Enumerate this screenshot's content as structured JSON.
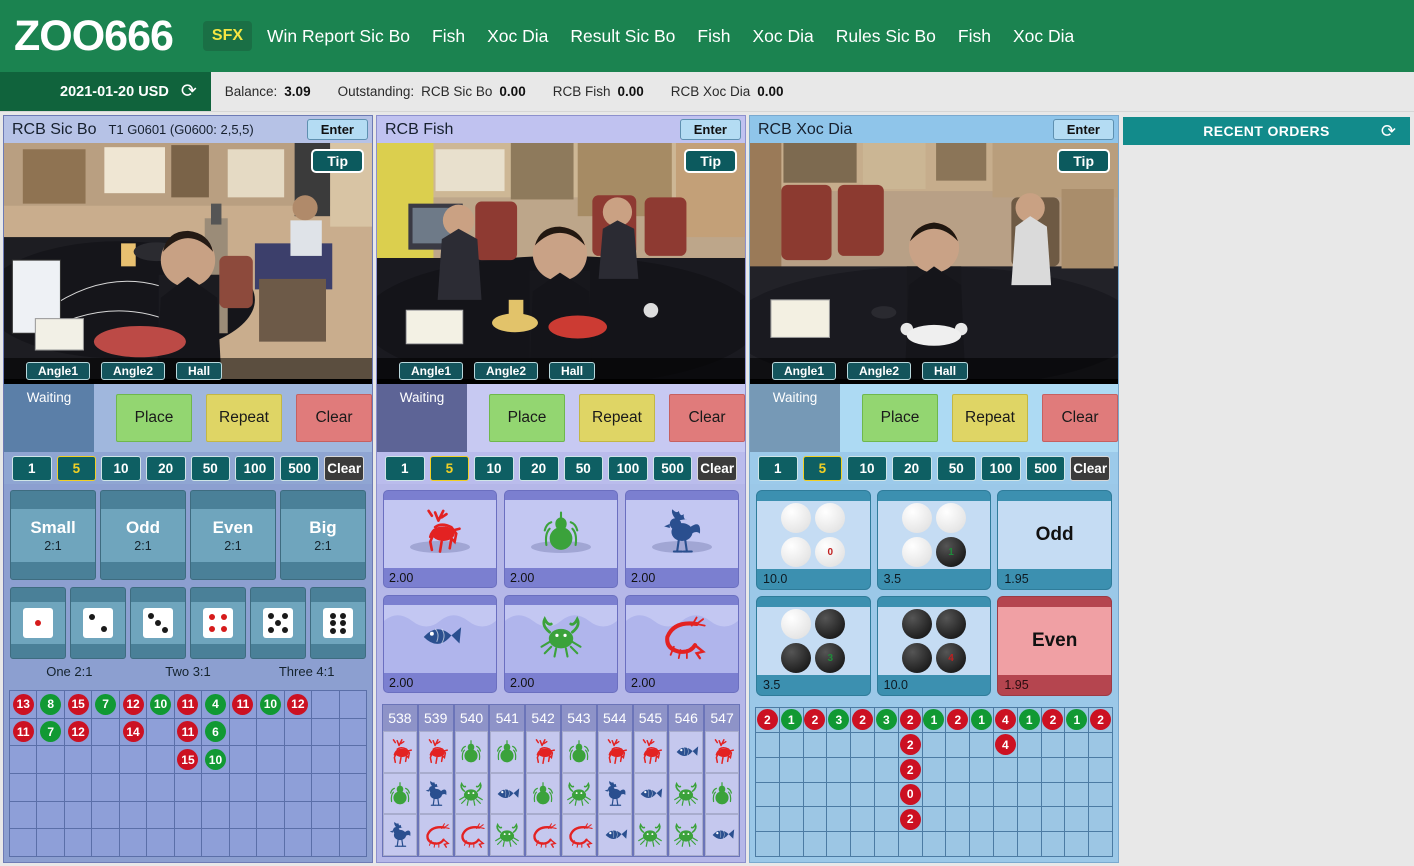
{
  "topnav": {
    "brand": "ZOO666",
    "items": [
      {
        "label": "SFX",
        "active": true
      },
      {
        "label": "Win Report Sic Bo",
        "active": false
      },
      {
        "label": "Fish",
        "active": false
      },
      {
        "label": "Xoc Dia",
        "active": false
      },
      {
        "label": "Result Sic Bo",
        "active": false
      },
      {
        "label": "Fish",
        "active": false
      },
      {
        "label": "Xoc Dia",
        "active": false
      },
      {
        "label": "Rules Sic Bo",
        "active": false
      },
      {
        "label": "Fish",
        "active": false
      },
      {
        "label": "Xoc Dia",
        "active": false
      }
    ]
  },
  "infobar": {
    "date": "2021-01-20 USD",
    "refresh_icon": "refresh-icon",
    "balance_label": "Balance:",
    "balance_value": "3.09",
    "outstanding_label": "Outstanding:",
    "outstanding": [
      {
        "label": "RCB Sic Bo",
        "value": "0.00"
      },
      {
        "label": "RCB Fish",
        "value": "0.00"
      },
      {
        "label": "RCB Xoc Dia",
        "value": "0.00"
      }
    ]
  },
  "common": {
    "enter_label": "Enter",
    "tip_label": "Tip",
    "angle_buttons": [
      "Angle1",
      "Angle2",
      "Hall"
    ],
    "status_waiting": "Waiting",
    "place_label": "Place",
    "repeat_label": "Repeat",
    "clear_label": "Clear",
    "chips": [
      "1",
      "5",
      "10",
      "20",
      "50",
      "100",
      "500"
    ],
    "chip_clear": "Clear",
    "chip_selected": "5"
  },
  "sicbo": {
    "title": "RCB Sic Bo",
    "game_info": "T1 G0601 (G0600: 2,5,5)",
    "bets_row1": [
      {
        "name": "Small",
        "odds": "2:1"
      },
      {
        "name": "Odd",
        "odds": "2:1"
      },
      {
        "name": "Even",
        "odds": "2:1"
      },
      {
        "name": "Big",
        "odds": "2:1"
      }
    ],
    "dice_faces": [
      1,
      2,
      3,
      4,
      5,
      6
    ],
    "dice_labels": [
      "One  2:1",
      "Two  3:1",
      "Three  4:1"
    ],
    "history_cols": 13,
    "history_rows": 6,
    "history": [
      [
        {
          "v": "13",
          "c": "red"
        },
        {
          "v": "11",
          "c": "red"
        }
      ],
      [
        {
          "v": "8",
          "c": "green"
        },
        {
          "v": "7",
          "c": "green"
        }
      ],
      [
        {
          "v": "15",
          "c": "red"
        },
        {
          "v": "12",
          "c": "red"
        }
      ],
      [
        {
          "v": "7",
          "c": "green"
        }
      ],
      [
        {
          "v": "12",
          "c": "red"
        },
        {
          "v": "14",
          "c": "red"
        }
      ],
      [
        {
          "v": "10",
          "c": "green"
        }
      ],
      [
        {
          "v": "11",
          "c": "red"
        },
        {
          "v": "11",
          "c": "red"
        },
        {
          "v": "15",
          "c": "red"
        }
      ],
      [
        {
          "v": "4",
          "c": "green"
        },
        {
          "v": "6",
          "c": "green"
        },
        {
          "v": "10",
          "c": "green"
        }
      ],
      [
        {
          "v": "11",
          "c": "red"
        }
      ],
      [
        {
          "v": "10",
          "c": "green"
        }
      ],
      [
        {
          "v": "12",
          "c": "red"
        }
      ],
      [],
      []
    ]
  },
  "fish": {
    "title": "RCB Fish",
    "game_info": "",
    "tiles": [
      {
        "animal": "deer",
        "odds": "2.00",
        "color": "#e32222"
      },
      {
        "animal": "gourd",
        "odds": "2.00",
        "color": "#3ba23b"
      },
      {
        "animal": "rooster",
        "odds": "2.00",
        "color": "#2a4f8f"
      },
      {
        "animal": "fish",
        "odds": "2.00",
        "color": "#2a4f8f"
      },
      {
        "animal": "crab",
        "odds": "2.00",
        "color": "#3ba23b"
      },
      {
        "animal": "shrimp",
        "odds": "2.00",
        "color": "#e32222"
      }
    ],
    "history_headers": [
      "538",
      "539",
      "540",
      "541",
      "542",
      "543",
      "544",
      "545",
      "546",
      "547"
    ],
    "history": [
      [
        "deer",
        "gourd",
        "rooster"
      ],
      [
        "deer",
        "rooster",
        "shrimp"
      ],
      [
        "gourd",
        "crab",
        "shrimp"
      ],
      [
        "gourd",
        "fish",
        "crab"
      ],
      [
        "deer",
        "gourd",
        "shrimp"
      ],
      [
        "gourd",
        "crab",
        "shrimp"
      ],
      [
        "deer",
        "rooster",
        "fish"
      ],
      [
        "deer",
        "fish",
        "crab"
      ],
      [
        "fish",
        "crab",
        "crab"
      ],
      [
        "deer",
        "gourd",
        "fish"
      ]
    ]
  },
  "xocdia": {
    "title": "RCB Xoc Dia",
    "game_info": "",
    "tiles": [
      {
        "kind": "coins",
        "pattern": [
          "w",
          "w",
          "w",
          "w"
        ],
        "badge": "0",
        "badge_color": "#c02020",
        "odds": "10.0"
      },
      {
        "kind": "coins",
        "pattern": [
          "w",
          "w",
          "w",
          "b"
        ],
        "badge": "1",
        "badge_color": "#1f8b3a",
        "odds": "3.5"
      },
      {
        "kind": "word",
        "word": "Odd",
        "odds": "1.95"
      },
      {
        "kind": "coins",
        "pattern": [
          "w",
          "b",
          "b",
          "b"
        ],
        "badge": "3",
        "badge_color": "#1f8b3a",
        "odds": "3.5"
      },
      {
        "kind": "coins",
        "pattern": [
          "b",
          "b",
          "b",
          "b"
        ],
        "badge": "4",
        "badge_color": "#c02020",
        "odds": "10.0"
      },
      {
        "kind": "word",
        "word": "Even",
        "odds": "1.95",
        "highlight": true
      }
    ],
    "history_cols": 15,
    "history_rows": 6,
    "history": [
      [
        {
          "v": "2",
          "c": "red"
        }
      ],
      [
        {
          "v": "1",
          "c": "green"
        }
      ],
      [
        {
          "v": "2",
          "c": "red"
        }
      ],
      [
        {
          "v": "3",
          "c": "green"
        }
      ],
      [
        {
          "v": "2",
          "c": "red"
        }
      ],
      [
        {
          "v": "3",
          "c": "green"
        }
      ],
      [
        {
          "v": "2",
          "c": "red"
        },
        {
          "v": "2",
          "c": "red"
        },
        {
          "v": "2",
          "c": "red"
        },
        {
          "v": "0",
          "c": "red"
        },
        {
          "v": "2",
          "c": "red"
        }
      ],
      [
        {
          "v": "1",
          "c": "green"
        }
      ],
      [
        {
          "v": "2",
          "c": "red"
        }
      ],
      [
        {
          "v": "1",
          "c": "green"
        }
      ],
      [
        {
          "v": "4",
          "c": "red"
        },
        {
          "v": "4",
          "c": "red"
        }
      ],
      [
        {
          "v": "1",
          "c": "green"
        }
      ],
      [
        {
          "v": "2",
          "c": "red"
        }
      ],
      [
        {
          "v": "1",
          "c": "green"
        }
      ],
      [
        {
          "v": "2",
          "c": "red"
        }
      ]
    ]
  },
  "recent_orders": {
    "title": "RECENT ORDERS",
    "refresh_icon": "refresh-icon"
  }
}
